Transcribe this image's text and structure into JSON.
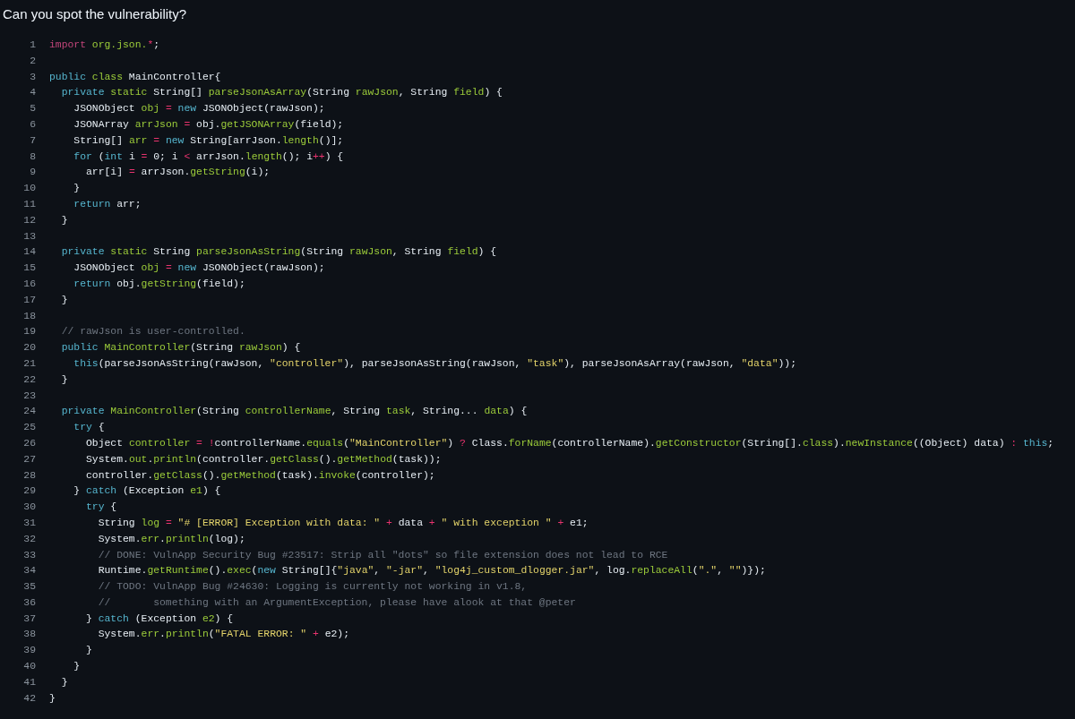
{
  "title": "Can you spot the vulnerability?",
  "code": {
    "lines": [
      {
        "number": "1",
        "tokens": [
          {
            "kind": "import",
            "text": "import"
          },
          {
            "kind": "name",
            "text": " org.json."
          },
          {
            "kind": "op",
            "text": "*"
          },
          {
            "kind": "plain",
            "text": ";"
          }
        ]
      },
      {
        "number": "2"
      },
      {
        "number": "3",
        "tokens": [
          {
            "kind": "keyword",
            "text": "public"
          },
          {
            "kind": "name",
            "text": " class"
          },
          {
            "kind": "plain",
            "text": " MainController{"
          }
        ]
      },
      {
        "number": "4",
        "tokens": [
          {
            "kind": "keyword",
            "text": "  private"
          },
          {
            "kind": "name",
            "text": " static"
          },
          {
            "kind": "plain",
            "text": " String[] "
          },
          {
            "kind": "name",
            "text": "parseJsonAsArray"
          },
          {
            "kind": "plain",
            "text": "(String "
          },
          {
            "kind": "name",
            "text": "rawJson"
          },
          {
            "kind": "plain",
            "text": ", String "
          },
          {
            "kind": "name",
            "text": "field"
          },
          {
            "kind": "plain",
            "text": ") {"
          }
        ]
      },
      {
        "number": "5",
        "tokens": [
          {
            "kind": "plain",
            "text": "    JSONObject "
          },
          {
            "kind": "name",
            "text": "obj"
          },
          {
            "kind": "op",
            "text": " ="
          },
          {
            "kind": "keyword",
            "text": " new"
          },
          {
            "kind": "plain",
            "text": " JSONObject(rawJson);"
          }
        ]
      },
      {
        "number": "6",
        "tokens": [
          {
            "kind": "plain",
            "text": "    JSONArray "
          },
          {
            "kind": "name",
            "text": "arrJson"
          },
          {
            "kind": "op",
            "text": " ="
          },
          {
            "kind": "plain",
            "text": " obj."
          },
          {
            "kind": "name",
            "text": "getJSONArray"
          },
          {
            "kind": "plain",
            "text": "(field);"
          }
        ]
      },
      {
        "number": "7",
        "tokens": [
          {
            "kind": "plain",
            "text": "    String[] "
          },
          {
            "kind": "name",
            "text": "arr"
          },
          {
            "kind": "op",
            "text": " ="
          },
          {
            "kind": "keyword",
            "text": " new"
          },
          {
            "kind": "plain",
            "text": " String[arrJson."
          },
          {
            "kind": "name",
            "text": "length"
          },
          {
            "kind": "plain",
            "text": "()];"
          }
        ]
      },
      {
        "number": "8",
        "tokens": [
          {
            "kind": "keyword",
            "text": "    for"
          },
          {
            "kind": "plain",
            "text": " ("
          },
          {
            "kind": "keyword",
            "text": "int"
          },
          {
            "kind": "plain",
            "text": " i "
          },
          {
            "kind": "op",
            "text": "="
          },
          {
            "kind": "plain",
            "text": " 0; i "
          },
          {
            "kind": "op",
            "text": "<"
          },
          {
            "kind": "plain",
            "text": " arrJson."
          },
          {
            "kind": "name",
            "text": "length"
          },
          {
            "kind": "plain",
            "text": "(); i"
          },
          {
            "kind": "op",
            "text": "++"
          },
          {
            "kind": "plain",
            "text": ") {"
          }
        ]
      },
      {
        "number": "9",
        "tokens": [
          {
            "kind": "plain",
            "text": "      arr[i] "
          },
          {
            "kind": "op",
            "text": "="
          },
          {
            "kind": "plain",
            "text": " arrJson."
          },
          {
            "kind": "name",
            "text": "getString"
          },
          {
            "kind": "plain",
            "text": "(i);"
          }
        ]
      },
      {
        "number": "10",
        "tokens": [
          {
            "kind": "plain",
            "text": "    }"
          }
        ]
      },
      {
        "number": "11",
        "tokens": [
          {
            "kind": "keyword",
            "text": "    return"
          },
          {
            "kind": "plain",
            "text": " arr;"
          }
        ]
      },
      {
        "number": "12",
        "tokens": [
          {
            "kind": "plain",
            "text": "  }"
          }
        ]
      },
      {
        "number": "13"
      },
      {
        "number": "14",
        "tokens": [
          {
            "kind": "keyword",
            "text": "  private"
          },
          {
            "kind": "name",
            "text": " static"
          },
          {
            "kind": "plain",
            "text": " String "
          },
          {
            "kind": "name",
            "text": "parseJsonAsString"
          },
          {
            "kind": "plain",
            "text": "(String "
          },
          {
            "kind": "name",
            "text": "rawJson"
          },
          {
            "kind": "plain",
            "text": ", String "
          },
          {
            "kind": "name",
            "text": "field"
          },
          {
            "kind": "plain",
            "text": ") {"
          }
        ]
      },
      {
        "number": "15",
        "tokens": [
          {
            "kind": "plain",
            "text": "    JSONObject "
          },
          {
            "kind": "name",
            "text": "obj"
          },
          {
            "kind": "op",
            "text": " ="
          },
          {
            "kind": "keyword",
            "text": " new"
          },
          {
            "kind": "plain",
            "text": " JSONObject(rawJson);"
          }
        ]
      },
      {
        "number": "16",
        "tokens": [
          {
            "kind": "keyword",
            "text": "    return"
          },
          {
            "kind": "plain",
            "text": " obj."
          },
          {
            "kind": "name",
            "text": "getString"
          },
          {
            "kind": "plain",
            "text": "(field);"
          }
        ]
      },
      {
        "number": "17",
        "tokens": [
          {
            "kind": "plain",
            "text": "  }"
          }
        ]
      },
      {
        "number": "18"
      },
      {
        "number": "19",
        "tokens": [
          {
            "kind": "comment",
            "text": "  // rawJson is user-controlled."
          }
        ]
      },
      {
        "number": "20",
        "tokens": [
          {
            "kind": "keyword",
            "text": "  public"
          },
          {
            "kind": "name",
            "text": " MainController"
          },
          {
            "kind": "plain",
            "text": "(String "
          },
          {
            "kind": "name",
            "text": "rawJson"
          },
          {
            "kind": "plain",
            "text": ") {"
          }
        ]
      },
      {
        "number": "21",
        "tokens": [
          {
            "kind": "keyword",
            "text": "    this"
          },
          {
            "kind": "plain",
            "text": "(parseJsonAsString(rawJson, "
          },
          {
            "kind": "string",
            "text": "\"controller\""
          },
          {
            "kind": "plain",
            "text": "), parseJsonAsString(rawJson, "
          },
          {
            "kind": "string",
            "text": "\"task\""
          },
          {
            "kind": "plain",
            "text": "), parseJsonAsArray(rawJson, "
          },
          {
            "kind": "string",
            "text": "\"data\""
          },
          {
            "kind": "plain",
            "text": "));"
          }
        ]
      },
      {
        "number": "22",
        "tokens": [
          {
            "kind": "plain",
            "text": "  }"
          }
        ]
      },
      {
        "number": "23"
      },
      {
        "number": "24",
        "tokens": [
          {
            "kind": "keyword",
            "text": "  private"
          },
          {
            "kind": "name",
            "text": " MainController"
          },
          {
            "kind": "plain",
            "text": "(String "
          },
          {
            "kind": "name",
            "text": "controllerName"
          },
          {
            "kind": "plain",
            "text": ", String "
          },
          {
            "kind": "name",
            "text": "task"
          },
          {
            "kind": "plain",
            "text": ", String... "
          },
          {
            "kind": "name",
            "text": "data"
          },
          {
            "kind": "plain",
            "text": ") {"
          }
        ]
      },
      {
        "number": "25",
        "tokens": [
          {
            "kind": "keyword",
            "text": "    try"
          },
          {
            "kind": "plain",
            "text": " {"
          }
        ]
      },
      {
        "number": "26",
        "tokens": [
          {
            "kind": "plain",
            "text": "      Object "
          },
          {
            "kind": "name",
            "text": "controller"
          },
          {
            "kind": "op",
            "text": " ="
          },
          {
            "kind": "op",
            "text": " !"
          },
          {
            "kind": "plain",
            "text": "controllerName."
          },
          {
            "kind": "name",
            "text": "equals"
          },
          {
            "kind": "plain",
            "text": "("
          },
          {
            "kind": "string",
            "text": "\"MainController\""
          },
          {
            "kind": "plain",
            "text": ") "
          },
          {
            "kind": "op",
            "text": "?"
          },
          {
            "kind": "plain",
            "text": " Class."
          },
          {
            "kind": "name",
            "text": "forName"
          },
          {
            "kind": "plain",
            "text": "(controllerName)."
          },
          {
            "kind": "name",
            "text": "getConstructor"
          },
          {
            "kind": "plain",
            "text": "(String[]."
          },
          {
            "kind": "name",
            "text": "class"
          },
          {
            "kind": "plain",
            "text": ")."
          },
          {
            "kind": "name",
            "text": "newInstance"
          },
          {
            "kind": "plain",
            "text": "((Object) data) "
          },
          {
            "kind": "op",
            "text": ":"
          },
          {
            "kind": "keyword",
            "text": " this"
          },
          {
            "kind": "plain",
            "text": ";"
          }
        ]
      },
      {
        "number": "27",
        "tokens": [
          {
            "kind": "plain",
            "text": "      System."
          },
          {
            "kind": "name",
            "text": "out"
          },
          {
            "kind": "plain",
            "text": "."
          },
          {
            "kind": "name",
            "text": "println"
          },
          {
            "kind": "plain",
            "text": "(controller."
          },
          {
            "kind": "name",
            "text": "getClass"
          },
          {
            "kind": "plain",
            "text": "()."
          },
          {
            "kind": "name",
            "text": "getMethod"
          },
          {
            "kind": "plain",
            "text": "(task));"
          }
        ]
      },
      {
        "number": "28",
        "tokens": [
          {
            "kind": "plain",
            "text": "      controller."
          },
          {
            "kind": "name",
            "text": "getClass"
          },
          {
            "kind": "plain",
            "text": "()."
          },
          {
            "kind": "name",
            "text": "getMethod"
          },
          {
            "kind": "plain",
            "text": "(task)."
          },
          {
            "kind": "name",
            "text": "invoke"
          },
          {
            "kind": "plain",
            "text": "(controller);"
          }
        ]
      },
      {
        "number": "29",
        "tokens": [
          {
            "kind": "plain",
            "text": "    } "
          },
          {
            "kind": "keyword",
            "text": "catch"
          },
          {
            "kind": "plain",
            "text": " (Exception "
          },
          {
            "kind": "name",
            "text": "e1"
          },
          {
            "kind": "plain",
            "text": ") {"
          }
        ]
      },
      {
        "number": "30",
        "tokens": [
          {
            "kind": "keyword",
            "text": "      try"
          },
          {
            "kind": "plain",
            "text": " {"
          }
        ]
      },
      {
        "number": "31",
        "tokens": [
          {
            "kind": "plain",
            "text": "        String "
          },
          {
            "kind": "name",
            "text": "log"
          },
          {
            "kind": "op",
            "text": " ="
          },
          {
            "kind": "string",
            "text": " \"# [ERROR] Exception with data: \""
          },
          {
            "kind": "op",
            "text": " +"
          },
          {
            "kind": "plain",
            "text": " data "
          },
          {
            "kind": "op",
            "text": "+"
          },
          {
            "kind": "string",
            "text": " \" with exception \""
          },
          {
            "kind": "op",
            "text": " +"
          },
          {
            "kind": "plain",
            "text": " e1;"
          }
        ]
      },
      {
        "number": "32",
        "tokens": [
          {
            "kind": "plain",
            "text": "        System."
          },
          {
            "kind": "name",
            "text": "err"
          },
          {
            "kind": "plain",
            "text": "."
          },
          {
            "kind": "name",
            "text": "println"
          },
          {
            "kind": "plain",
            "text": "(log);"
          }
        ]
      },
      {
        "number": "33",
        "tokens": [
          {
            "kind": "comment",
            "text": "        // DONE: VulnApp Security Bug #23517: Strip all \"dots\" so file extension does not lead to RCE"
          }
        ]
      },
      {
        "number": "34",
        "tokens": [
          {
            "kind": "plain",
            "text": "        Runtime."
          },
          {
            "kind": "name",
            "text": "getRuntime"
          },
          {
            "kind": "plain",
            "text": "()."
          },
          {
            "kind": "name",
            "text": "exec"
          },
          {
            "kind": "plain",
            "text": "("
          },
          {
            "kind": "keyword",
            "text": "new"
          },
          {
            "kind": "plain",
            "text": " String[]{"
          },
          {
            "kind": "string",
            "text": "\"java\""
          },
          {
            "kind": "plain",
            "text": ", "
          },
          {
            "kind": "string",
            "text": "\"-jar\""
          },
          {
            "kind": "plain",
            "text": ", "
          },
          {
            "kind": "string",
            "text": "\"log4j_custom_dlogger.jar\""
          },
          {
            "kind": "plain",
            "text": ", log."
          },
          {
            "kind": "name",
            "text": "replaceAll"
          },
          {
            "kind": "plain",
            "text": "("
          },
          {
            "kind": "string",
            "text": "\".\""
          },
          {
            "kind": "plain",
            "text": ", "
          },
          {
            "kind": "string",
            "text": "\"\""
          },
          {
            "kind": "plain",
            "text": ")});"
          }
        ]
      },
      {
        "number": "35",
        "tokens": [
          {
            "kind": "comment",
            "text": "        // TODO: VulnApp Bug #24630: Logging is currently not working in v1.8,"
          }
        ]
      },
      {
        "number": "36",
        "tokens": [
          {
            "kind": "comment",
            "text": "        //       something with an ArgumentException, please have alook at that @peter"
          }
        ]
      },
      {
        "number": "37",
        "tokens": [
          {
            "kind": "plain",
            "text": "      } "
          },
          {
            "kind": "keyword",
            "text": "catch"
          },
          {
            "kind": "plain",
            "text": " (Exception "
          },
          {
            "kind": "name",
            "text": "e2"
          },
          {
            "kind": "plain",
            "text": ") {"
          }
        ]
      },
      {
        "number": "38",
        "tokens": [
          {
            "kind": "plain",
            "text": "        System."
          },
          {
            "kind": "name",
            "text": "err"
          },
          {
            "kind": "plain",
            "text": "."
          },
          {
            "kind": "name",
            "text": "println"
          },
          {
            "kind": "plain",
            "text": "("
          },
          {
            "kind": "string",
            "text": "\"FATAL ERROR: \""
          },
          {
            "kind": "op",
            "text": " +"
          },
          {
            "kind": "plain",
            "text": " e2);"
          }
        ]
      },
      {
        "number": "39",
        "tokens": [
          {
            "kind": "plain",
            "text": "      }"
          }
        ]
      },
      {
        "number": "40",
        "tokens": [
          {
            "kind": "plain",
            "text": "    }"
          }
        ]
      },
      {
        "number": "41",
        "tokens": [
          {
            "kind": "plain",
            "text": "  }"
          }
        ]
      },
      {
        "number": "42",
        "tokens": [
          {
            "kind": "plain",
            "text": "}"
          }
        ]
      }
    ]
  }
}
